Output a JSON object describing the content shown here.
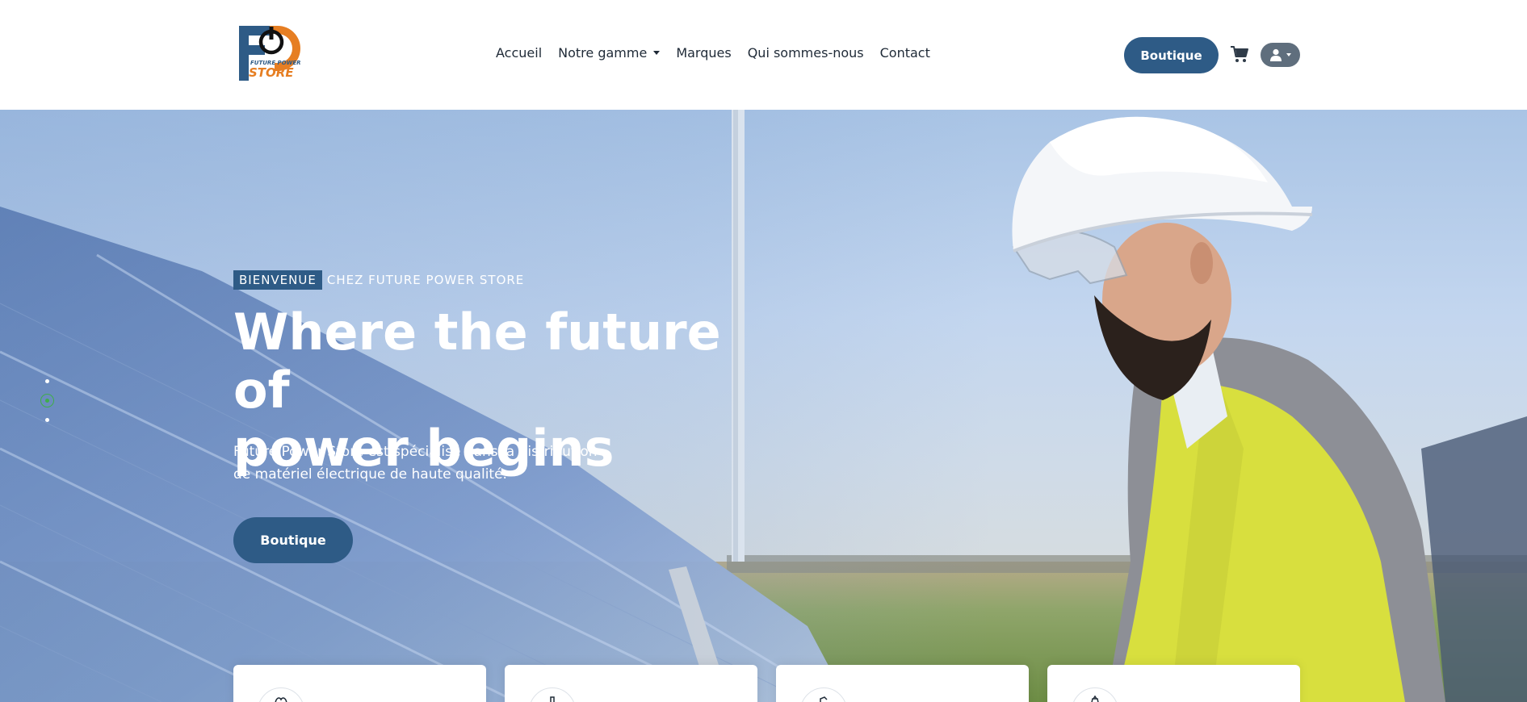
{
  "brand": {
    "logo_letters": "FP",
    "logo_tagline": "FUTURE POWER",
    "logo_word": "STORE",
    "colors": {
      "primary": "#2e5b86",
      "accent_orange": "#e67e22",
      "accent_green": "#3fae49"
    }
  },
  "nav": {
    "items": [
      {
        "label": "Accueil"
      },
      {
        "label": "Notre gamme",
        "has_dropdown": true
      },
      {
        "label": "Marques"
      },
      {
        "label": "Qui sommes-nous"
      },
      {
        "label": "Contact"
      }
    ],
    "shop_button": "Boutique",
    "cart_icon": "cart-icon",
    "user_icon": "user-icon"
  },
  "hero": {
    "welcome_tag": "BIENVENUE",
    "welcome_rest": "CHEZ FUTURE POWER STORE",
    "title_line1": "Where the future of",
    "title_line2": "power begins",
    "description_line1": "Future Power Store est spécialisé dans la distribution",
    "description_line2": "de matériel électrique de haute qualité.",
    "cta": "Boutique",
    "slides": {
      "count": 3,
      "active": 2
    }
  },
  "feature_cards": [
    {
      "icon": "feature-icon-1"
    },
    {
      "icon": "feature-icon-2"
    },
    {
      "icon": "feature-icon-3"
    },
    {
      "icon": "feature-icon-4"
    }
  ]
}
